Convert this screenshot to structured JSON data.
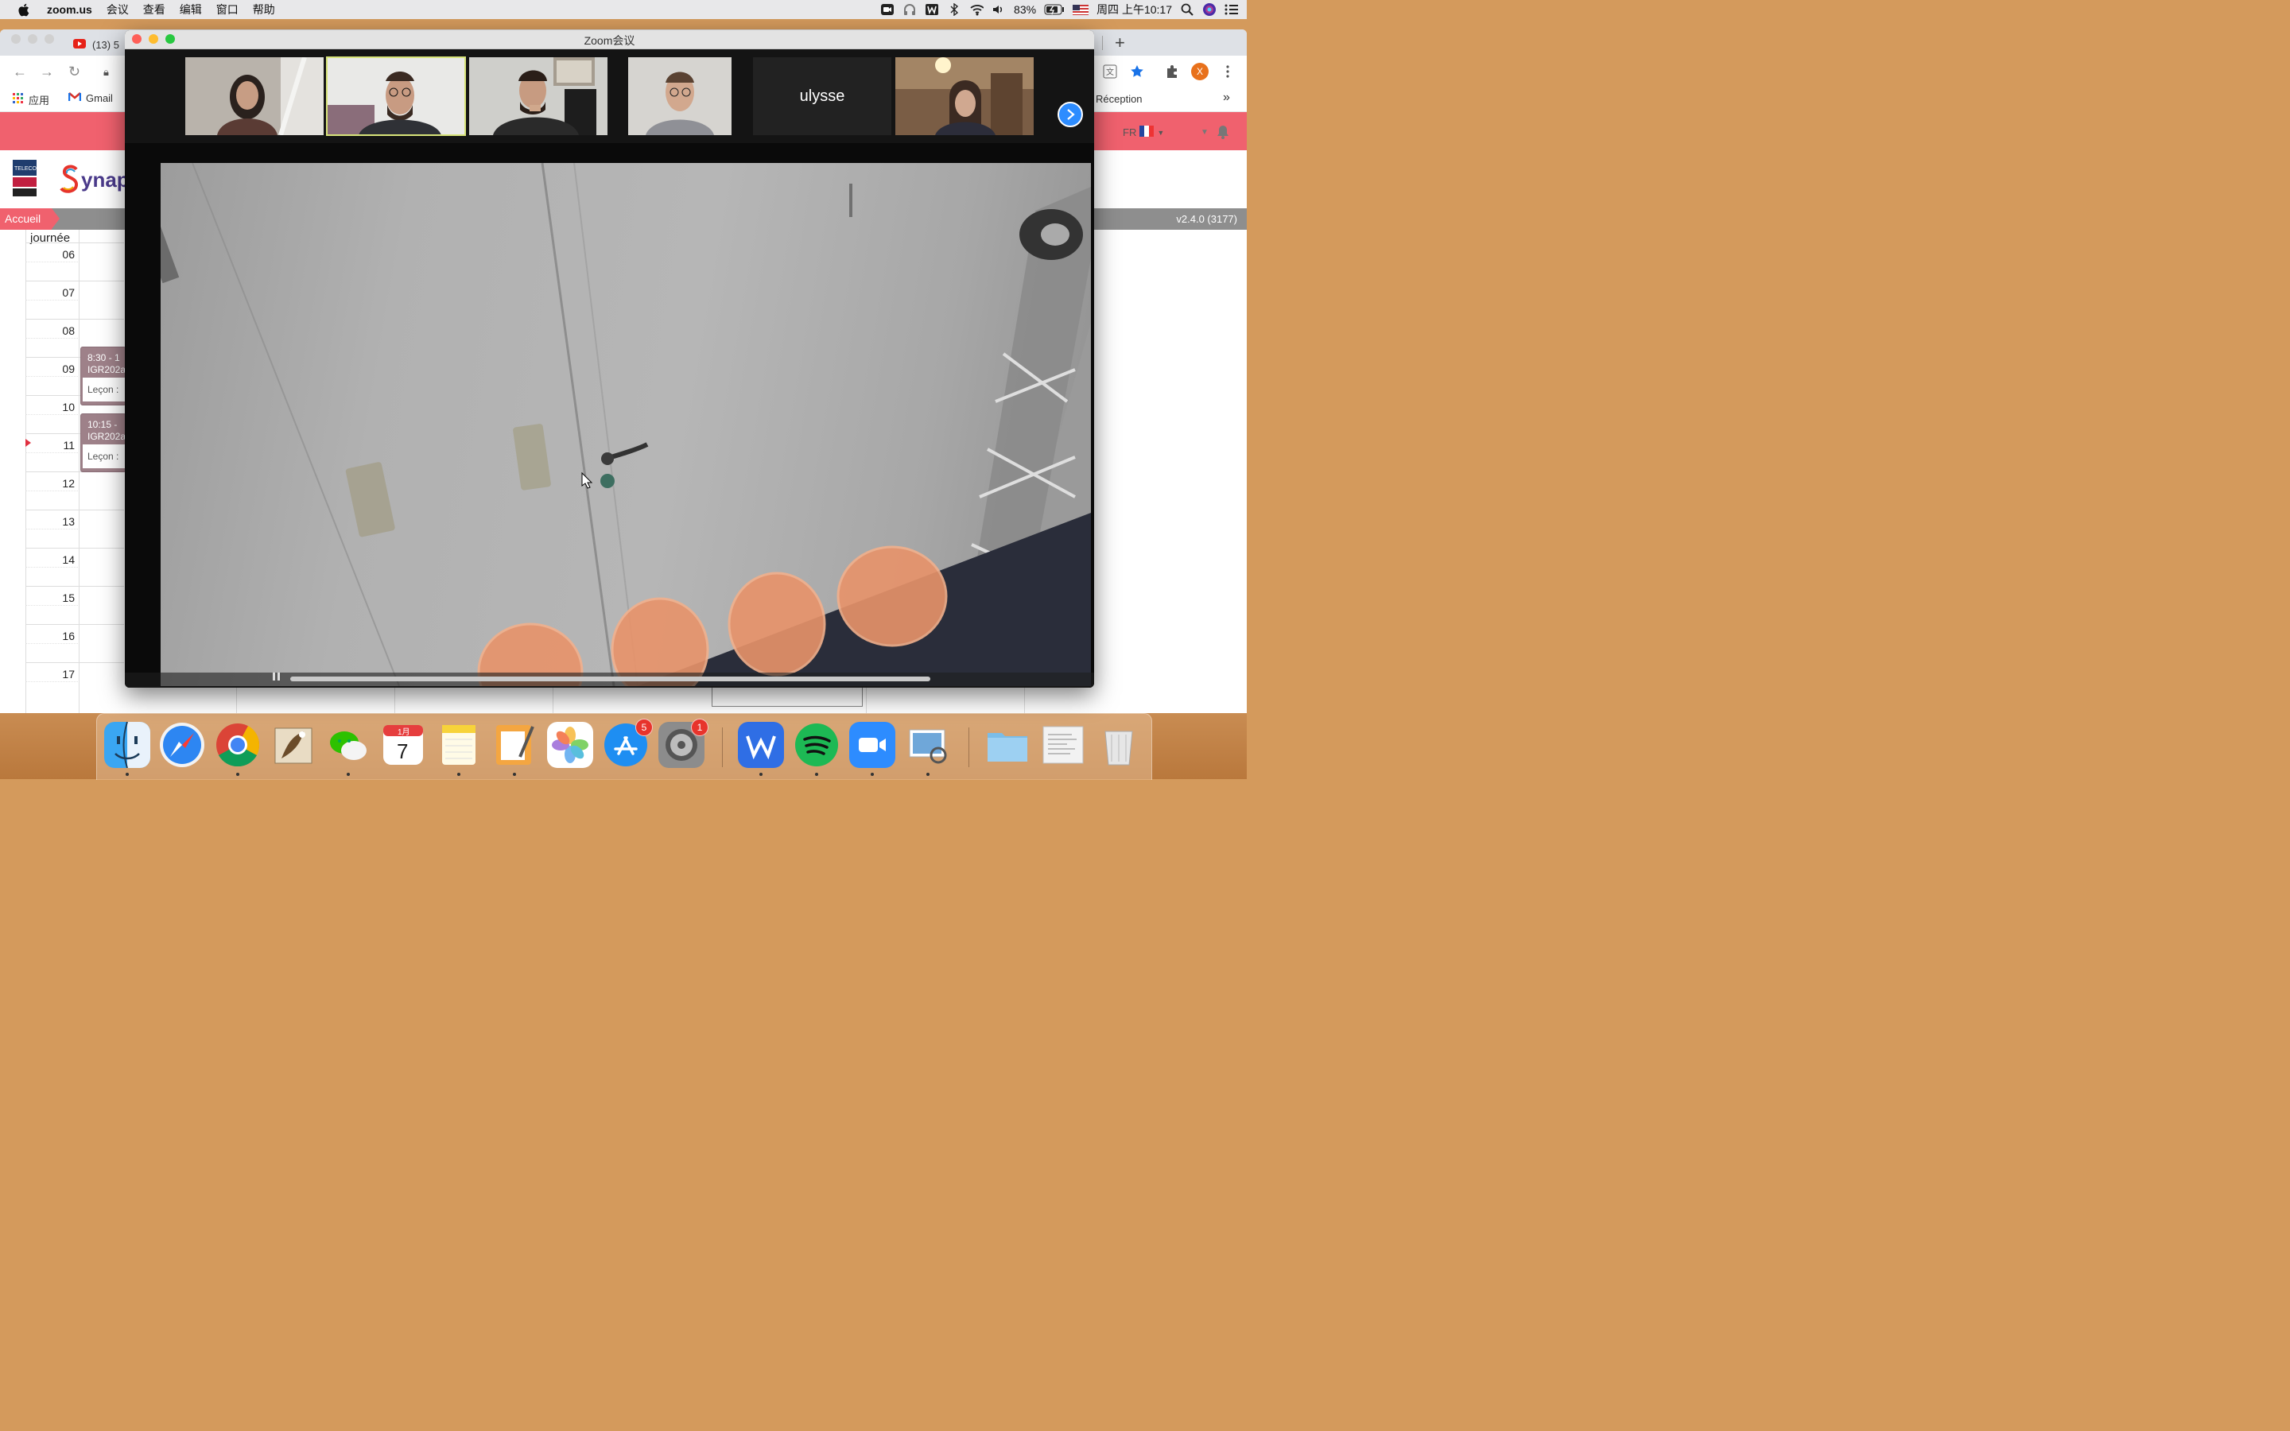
{
  "menubar": {
    "app_name": "zoom.us",
    "items": [
      "会议",
      "查看",
      "编辑",
      "窗口",
      "帮助"
    ],
    "battery": "83%",
    "datetime": "周四 上午10:17"
  },
  "browser": {
    "tab_title": "(13) 5",
    "bookmarks": {
      "apps": "应用",
      "gmail": "Gmail",
      "reception": "Réception",
      "more": "»"
    },
    "avatar_letter": "X"
  },
  "page": {
    "lang": "FR",
    "breadcrumb": "Accueil",
    "version": "v2.4.0 (3177)",
    "logo_text": "ynap",
    "calendar": {
      "header": "journée",
      "hours": [
        "06",
        "07",
        "08",
        "09",
        "10",
        "11",
        "12",
        "13",
        "14",
        "15",
        "16",
        "17"
      ],
      "events": [
        {
          "time": "8:30 - 1",
          "code": "IGR202a",
          "lesson": "Leçon : "
        },
        {
          "time": "10:15 - ",
          "code": "IGR202a",
          "lesson": "Leçon : "
        }
      ]
    }
  },
  "zoom": {
    "title": "Zoom会议",
    "participants": [
      {
        "name": "",
        "has_video": true
      },
      {
        "name": "",
        "has_video": true,
        "active_speaker": true
      },
      {
        "name": "",
        "has_video": true
      },
      {
        "name": "",
        "has_video": true
      },
      {
        "name": "ulysse",
        "has_video": false
      },
      {
        "name": "",
        "has_video": true
      }
    ]
  },
  "dock": {
    "apps": [
      "finder",
      "safari",
      "chrome",
      "mail",
      "wechat",
      "calendar",
      "notes",
      "pages",
      "photos",
      "app-store",
      "system-preferences",
      "wps",
      "spotify",
      "zoom",
      "preview",
      "downloads-folder",
      "documents",
      "trash"
    ],
    "calendar_month": "1月",
    "calendar_day": "7",
    "app_store_badge": "5",
    "system_prefs_badge": "1"
  },
  "colors": {
    "zoom_blue": "#2d8cff",
    "synapses_pink": "#f0616e",
    "active_speaker": "#d8e47a"
  }
}
